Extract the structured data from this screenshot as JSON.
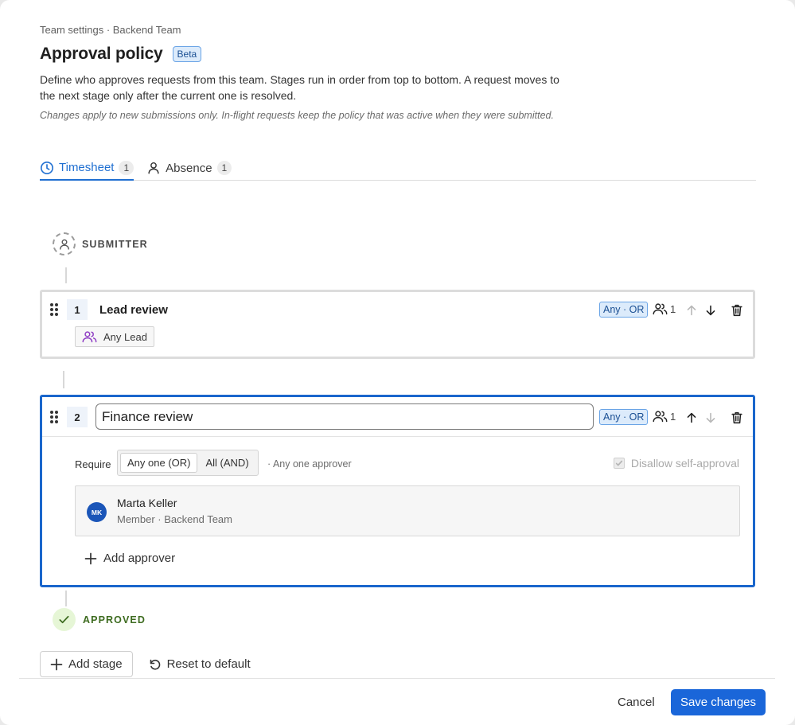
{
  "header": {
    "breadcrumb": "Team settings · Backend Team",
    "title": "Approval policy",
    "badge": "Beta",
    "description": "Define who approves requests from this team. Stages run in order from top to bottom. A request moves to the next stage only after the current one is resolved.",
    "note": "Changes apply to new submissions only. In-flight requests keep the policy that was active when they were submitted."
  },
  "tabs": [
    {
      "label": "Timesheet",
      "count": "1",
      "icon": "clock-icon",
      "active": true
    },
    {
      "label": "Absence",
      "count": "1",
      "icon": "person-icon",
      "active": false
    }
  ],
  "flow": {
    "start_label": "SUBMITTER",
    "end_label": "APPROVED"
  },
  "stages": [
    {
      "number": "1",
      "name": "Lead review",
      "mode": "Any · OR",
      "approver_count": "1",
      "approvers_chip": "Any Lead"
    },
    {
      "number": "2",
      "name": "Finance review",
      "mode": "Any · OR",
      "approver_count": "1",
      "require_label": "Require",
      "require_options": [
        "Any one (OR)",
        "All (AND)"
      ],
      "require_selected": "Any one (OR)",
      "require_hint": "· Any one approver",
      "disallow_self_approval": "Disallow self-approval",
      "approvers": [
        {
          "initials": "MK",
          "name": "Marta Keller",
          "role": "Member · Backend Team"
        }
      ],
      "add_approver": "Add approver"
    }
  ],
  "actions": {
    "add_stage": "Add stage",
    "reset": "Reset to default"
  },
  "footer": {
    "cancel": "Cancel",
    "save": "Save changes"
  },
  "colors": {
    "accent": "#1a66d9",
    "active_tab": "#1f6fd1",
    "approved_bg": "#e6f6d6",
    "approved_text": "#3d6b1f",
    "badge_bg": "#dcebfb",
    "purple_icon": "#8e3cc4"
  }
}
